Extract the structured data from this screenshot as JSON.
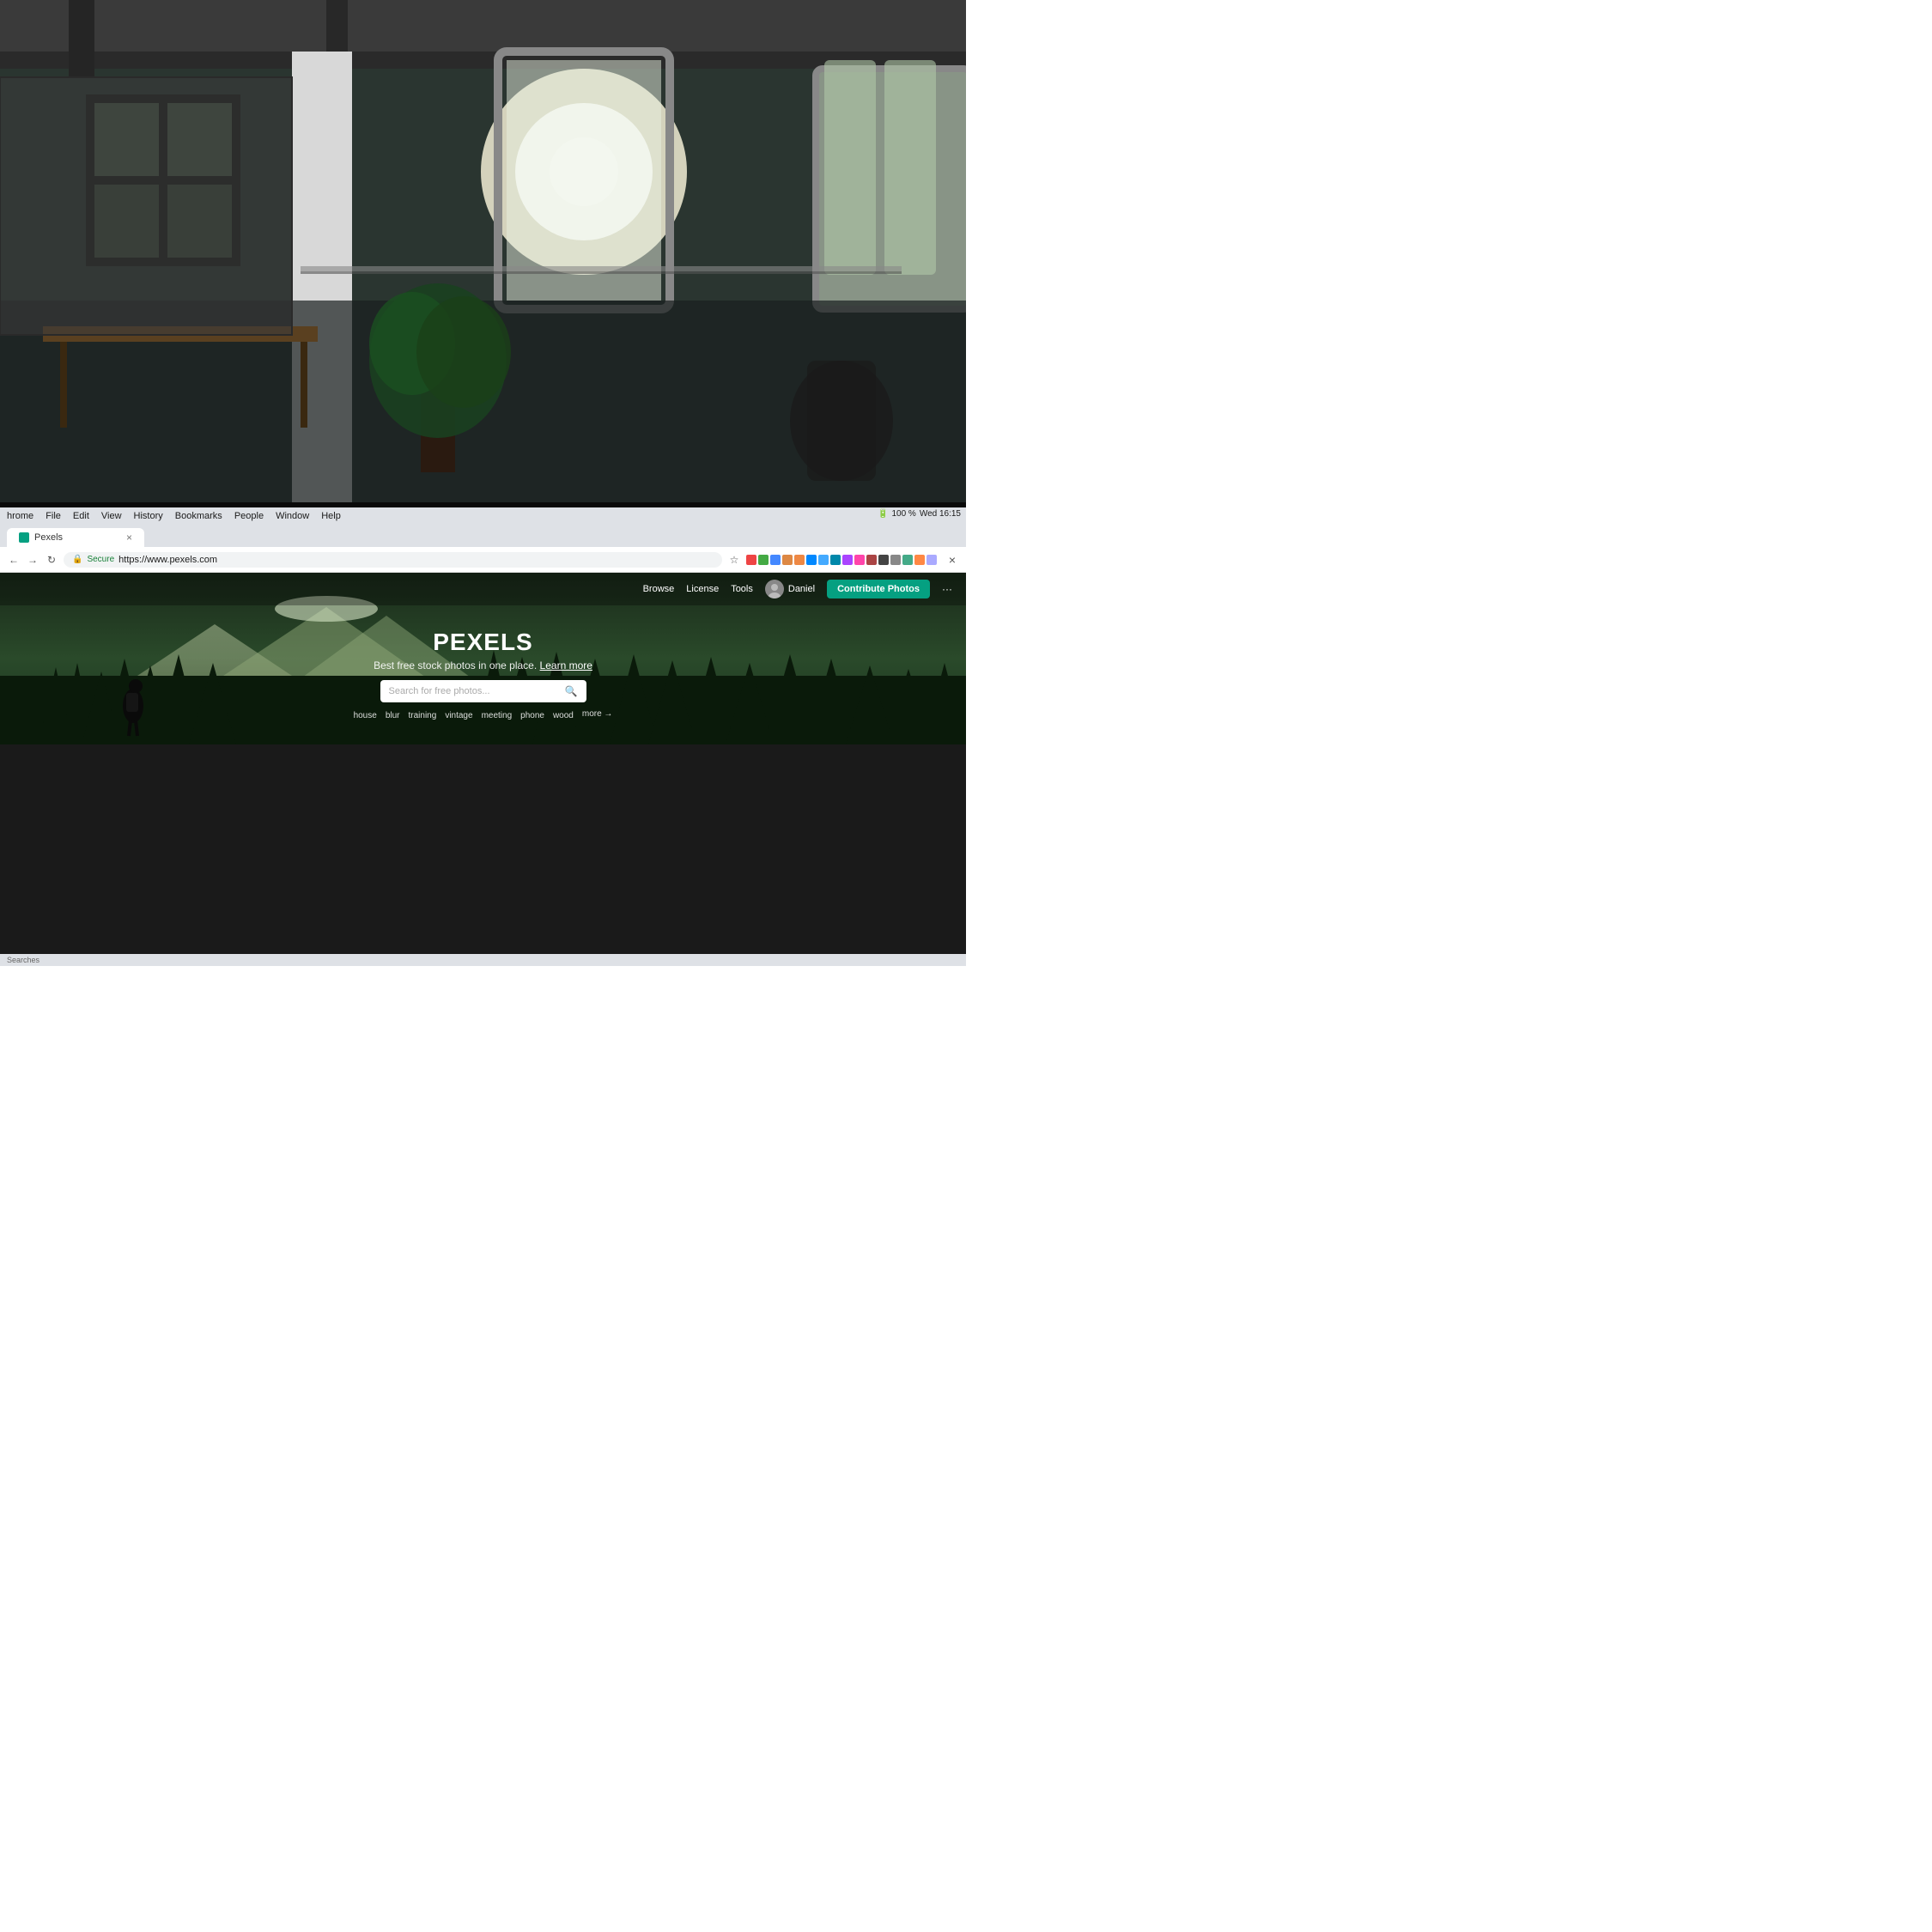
{
  "background": {
    "description": "Office interior with natural light, blurred background, laptop screen in foreground"
  },
  "browser": {
    "menubar": {
      "items": [
        "hrome",
        "File",
        "Edit",
        "View",
        "History",
        "Bookmarks",
        "People",
        "Window",
        "Help"
      ]
    },
    "system": {
      "time": "Wed 16:15",
      "battery": "100 %"
    },
    "tab": {
      "title": "Pexels",
      "close_label": "×"
    },
    "address": {
      "secure_label": "Secure",
      "url": "https://www.pexels.com"
    }
  },
  "pexels": {
    "nav": {
      "browse_label": "Browse",
      "license_label": "License",
      "tools_label": "Tools",
      "user_label": "Daniel",
      "contribute_label": "Contribute Photos",
      "more_label": "···"
    },
    "hero": {
      "logo": "PEXELS",
      "tagline": "Best free stock photos in one place.",
      "learn_more": "Learn more",
      "search_placeholder": "Search for free photos...",
      "suggestions": [
        "house",
        "blur",
        "training",
        "vintage",
        "meeting",
        "phone",
        "wood",
        "more →"
      ]
    }
  }
}
